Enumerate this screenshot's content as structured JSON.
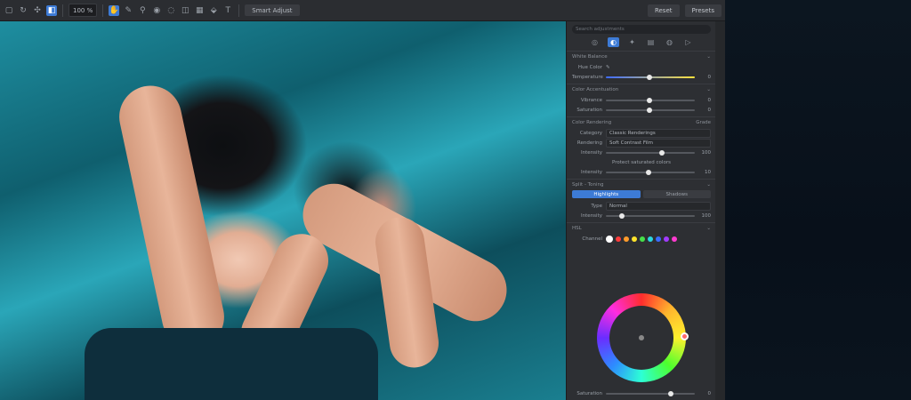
{
  "toolbar": {
    "zoom": "100 %",
    "mode_pill": "Smart Adjust",
    "reset_label": "Reset",
    "presets_label": "Presets"
  },
  "panel": {
    "search_placeholder": "Search adjustments",
    "sections": {
      "white_balance": {
        "title": "White Balance",
        "hue_color_label": "Hue Color",
        "temperature_label": "Temperature",
        "temperature_value": "0"
      },
      "color_accentuation": {
        "title": "Color Accentuation",
        "vibrance_label": "Vibrance",
        "saturation_label": "Saturation",
        "vibrance_value": "0",
        "saturation_value": "0"
      },
      "color_rendering": {
        "title": "Color Rendering",
        "action": "Grade",
        "category_label": "Category",
        "category_value": "Classic Renderings",
        "rendering_label": "Rendering",
        "rendering_value": "Soft Contrast Film",
        "intensity_label": "Intensity",
        "intensity_value": "100",
        "protect_label": "Protect saturated colors",
        "intensity2_value": "10"
      },
      "split_toning": {
        "title": "Split - Toning",
        "swatch_a": "Highlights",
        "swatch_b": "Shadows",
        "type_label": "Type",
        "type_value": "Normal",
        "intensity_label": "Intensity",
        "intensity_value": "100"
      },
      "hsl": {
        "title": "HSL",
        "channel_label": "Channel",
        "colors": [
          "#ffffff",
          "#ff3b3b",
          "#ff9c2b",
          "#ffe42b",
          "#46e04a",
          "#2bd6e0",
          "#3b6bff",
          "#a23bff",
          "#ff3bd0"
        ],
        "bottom_label": "Saturation",
        "bottom_value": "0"
      }
    }
  }
}
